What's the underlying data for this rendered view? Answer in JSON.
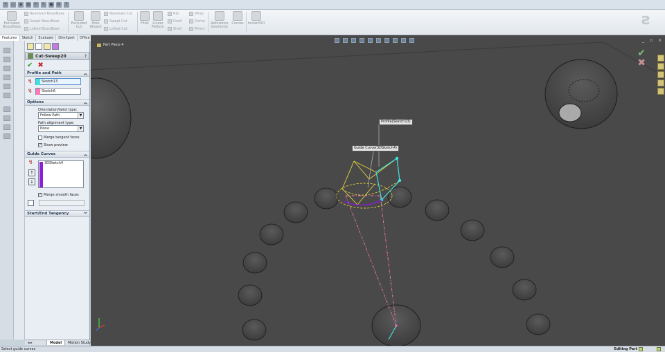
{
  "ribbon": {
    "extruded_boss": "Extruded Boss/Base",
    "revolved_boss": "Revolved Boss/Base",
    "swept_boss": "Swept Boss/Base",
    "lofted_boss": "Lofted Boss/Base",
    "extruded_cut": "Extruded Cut",
    "hole_wizard": "Hole Wizard",
    "revolved_cut": "Revolved Cut",
    "swept_cut": "Swept Cut",
    "lofted_cut": "Lofted Cut",
    "fillet": "Fillet",
    "linear_pattern": "Linear Pattern",
    "rib": "Rib",
    "draft": "Draft",
    "shell": "Shell",
    "wrap": "Wrap",
    "dome": "Dome",
    "mirror": "Mirror",
    "reference_geometry": "Reference Geometry",
    "curves": "Curves",
    "instant3d": "Instant3D"
  },
  "tabs": [
    "Features",
    "Sketch",
    "Evaluate",
    "DimXpert",
    "Office Products"
  ],
  "property_manager": {
    "title": "Cut-Sweep20",
    "help": "?",
    "ok": "✔",
    "cancel": "✖",
    "profile_path": {
      "header": "Profile and Path",
      "profile_value": "Sketch13",
      "path_value": "Sketch6"
    },
    "options": {
      "header": "Options",
      "orientation_label": "Orientation/twist type:",
      "orientation_value": "Follow Path",
      "path_alignment_label": "Path alignment type:",
      "path_alignment_value": "None",
      "merge_tangent": "Merge tangent faces",
      "show_preview": "Show preview"
    },
    "guide_curves": {
      "header": "Guide Curves",
      "item": "3DSketch4",
      "merge_smooth": "Merge smooth faces"
    },
    "start_end": {
      "header": "Start/End Tangency"
    }
  },
  "bottom_tabs": [
    "Model",
    "Motion Study 1"
  ],
  "viewport": {
    "tree_label": "Part Piece 4",
    "callout_profile": "Profile(Sketch13)",
    "callout_guide": "Guide Curve(3DSketch4)",
    "window_controls": "_ ▫ ×"
  },
  "status": {
    "message": "Select guide curves",
    "mode": "Editing Part"
  },
  "colors": {
    "viewport_bg": "#494949",
    "profile_color": "#3fe0e0",
    "path_color": "#ff77b4",
    "guide_color": "#8a1fd6",
    "preview_color": "#e5d23a"
  }
}
